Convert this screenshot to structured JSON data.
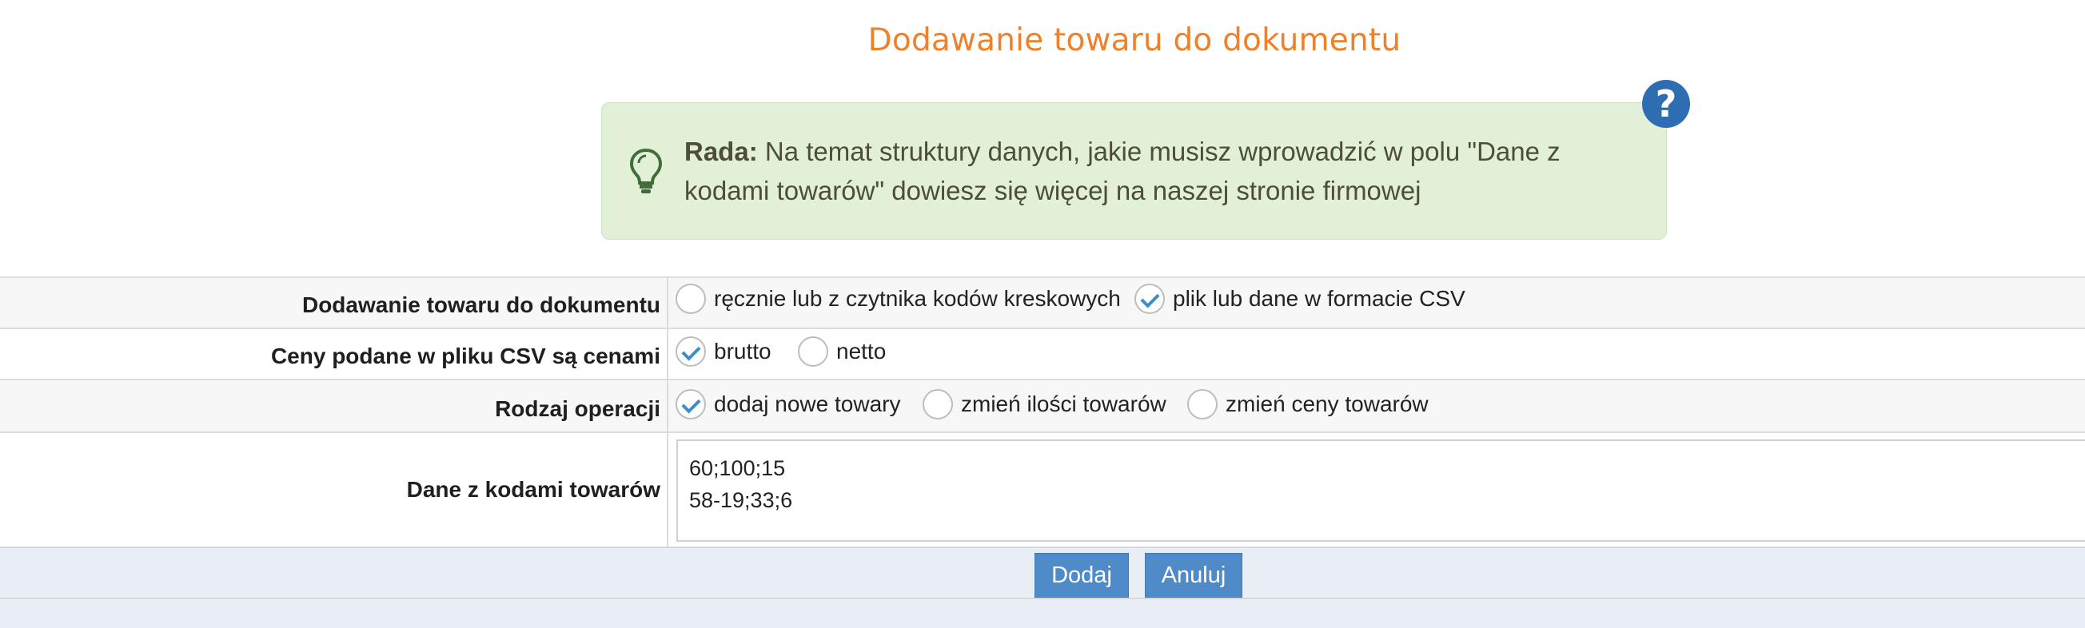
{
  "page": {
    "title": "Dodawanie towaru do dokumentu"
  },
  "tip": {
    "label": "Rada:",
    "text": "Na temat struktury danych, jakie musisz wprowadzić w polu \"Dane z kodami towarów\" dowiesz się więcej na naszej stronie firmowej",
    "icon": "lightbulb-icon"
  },
  "help": {
    "symbol": "?",
    "icon": "help-icon"
  },
  "form": {
    "add_mode": {
      "label": "Dodawanie towaru do dokumentu",
      "options": [
        {
          "label": "ręcznie lub z czytnika kodów kreskowych",
          "checked": false
        },
        {
          "label": "plik lub dane w formacie CSV",
          "checked": true
        }
      ]
    },
    "prices": {
      "label": "Ceny podane w pliku CSV są cenami",
      "options": [
        {
          "label": "brutto",
          "checked": true
        },
        {
          "label": "netto",
          "checked": false
        }
      ]
    },
    "operation": {
      "label": "Rodzaj operacji",
      "options": [
        {
          "label": "dodaj nowe towary",
          "checked": true
        },
        {
          "label": "zmień ilości towarów",
          "checked": false
        },
        {
          "label": "zmień ceny towarów",
          "checked": false
        }
      ]
    },
    "data": {
      "label": "Dane z kodami towarów",
      "value": "60;100;15\n58-19;33;6"
    }
  },
  "buttons": {
    "add": "Dodaj",
    "cancel": "Anuluj"
  },
  "colors": {
    "title": "#f0802a",
    "tip_bg": "#e3f0d8",
    "accent": "#4f8ac9",
    "help": "#2f6db3"
  }
}
